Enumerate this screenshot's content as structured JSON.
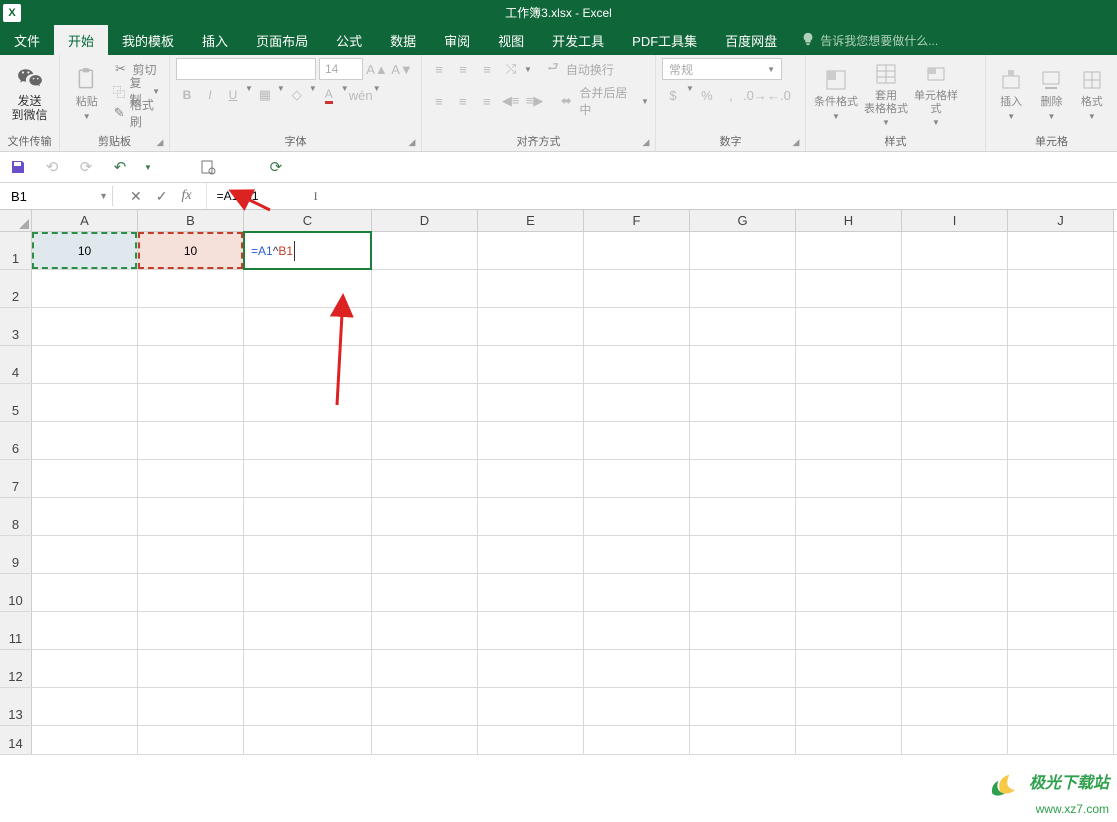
{
  "title": "工作簿3.xlsx - Excel",
  "menu": {
    "file": "文件",
    "home": "开始",
    "templates": "我的模板",
    "insert": "插入",
    "pagelayout": "页面布局",
    "formulas": "公式",
    "data": "数据",
    "review": "审阅",
    "view": "视图",
    "developer": "开发工具",
    "pdfkit": "PDF工具集",
    "baidudisk": "百度网盘",
    "tellme": "告诉我您想要做什么..."
  },
  "ribbon": {
    "wechat": {
      "send": "发送",
      "to": "到微信",
      "group": "文件传输"
    },
    "clipboard": {
      "paste": "粘贴",
      "cut": "剪切",
      "copy": "复制",
      "painter": "格式刷",
      "group": "剪贴板"
    },
    "font": {
      "name": "",
      "size": "14",
      "group": "字体"
    },
    "align": {
      "wrap": "自动换行",
      "merge": "合并后居中",
      "group": "对齐方式"
    },
    "number": {
      "format": "常规",
      "group": "数字"
    },
    "styles": {
      "cond": "条件格式",
      "table": "套用\n表格格式",
      "cellstyle": "单元格样式",
      "group": "样式"
    },
    "cells": {
      "insert": "插入",
      "delete": "删除",
      "format": "格式",
      "group": "单元格"
    }
  },
  "qat": {
    "save": "保存",
    "undo": "撤销",
    "redo": "重做"
  },
  "formula_bar": {
    "name_box": "B1",
    "cancel": "✕",
    "enter": "✓",
    "fx": "fx",
    "formula": "=A1^B1"
  },
  "columns": [
    "A",
    "B",
    "C",
    "D",
    "E",
    "F",
    "G",
    "H",
    "I",
    "J"
  ],
  "row_numbers": [
    "1",
    "2",
    "3",
    "4",
    "5",
    "6",
    "7",
    "8",
    "9",
    "10",
    "11",
    "12",
    "13",
    "14"
  ],
  "cells": {
    "A1": "10",
    "B1": "10",
    "C1_edit_a": "=A1",
    "C1_edit_op": "^",
    "C1_edit_b": "B1"
  },
  "watermark": {
    "line1": "极光下载站",
    "line2": "www.xz7.com"
  }
}
